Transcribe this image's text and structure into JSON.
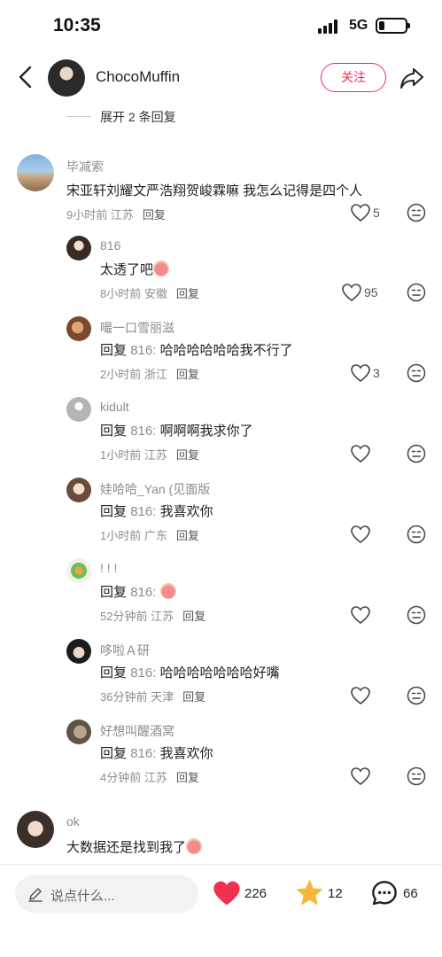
{
  "status": {
    "time": "10:35",
    "network": "5G"
  },
  "header": {
    "username": "ChocoMuffin",
    "follow_label": "关注"
  },
  "expand_label": "展开 2 条回复",
  "comments": [
    {
      "name": "毕减索",
      "text": "宋亚轩刘耀文严浩翔贺峻霖嘛 我怎么记得是四个人",
      "time": "9小时前",
      "location": "江苏",
      "reply_label": "回复",
      "likes": "5"
    },
    {
      "name": "816",
      "text": "太透了吧",
      "time": "8小时前",
      "location": "安徽",
      "reply_label": "回复",
      "likes": "95"
    },
    {
      "name": "嘬一口雪丽滋",
      "reply_prefix": "回复",
      "reply_to": "816:",
      "text": "哈哈哈哈哈哈我不行了",
      "time": "2小时前",
      "location": "浙江",
      "reply_label": "回复",
      "likes": "3"
    },
    {
      "name": "kidult",
      "reply_prefix": "回复",
      "reply_to": "816:",
      "text": "啊啊啊我求你了",
      "time": "1小时前",
      "location": "江苏",
      "reply_label": "回复",
      "likes": ""
    },
    {
      "name": "娃哈哈_Yan (见面版",
      "reply_prefix": "回复",
      "reply_to": "816:",
      "text": "我喜欢你",
      "time": "1小时前",
      "location": "广东",
      "reply_label": "回复",
      "likes": ""
    },
    {
      "name": "! ! !",
      "reply_prefix": "回复",
      "reply_to": "816:",
      "text": "",
      "time": "52分钟前",
      "location": "江苏",
      "reply_label": "回复",
      "likes": ""
    },
    {
      "name": "哆啦Ａ研",
      "reply_prefix": "回复",
      "reply_to": "816:",
      "text": "哈哈哈哈哈哈哈好嘴",
      "time": "36分钟前",
      "location": "天津",
      "reply_label": "回复",
      "likes": ""
    },
    {
      "name": "好想叫醒酒窝",
      "reply_prefix": "回复",
      "reply_to": "816:",
      "text": "我喜欢你",
      "time": "4分钟前",
      "location": "江苏",
      "reply_label": "回复",
      "likes": ""
    },
    {
      "name": "ok",
      "text": "大数据还是找到我了",
      "time": "",
      "location": "",
      "reply_label": "",
      "likes": ""
    }
  ],
  "bottom_bar": {
    "input_placeholder": "说点什么...",
    "likes": "226",
    "favorites": "12",
    "comments": "66"
  },
  "colors": {
    "accent": "#ee2d54",
    "like_red": "#f0304f",
    "star_yellow": "#f5b73b"
  }
}
